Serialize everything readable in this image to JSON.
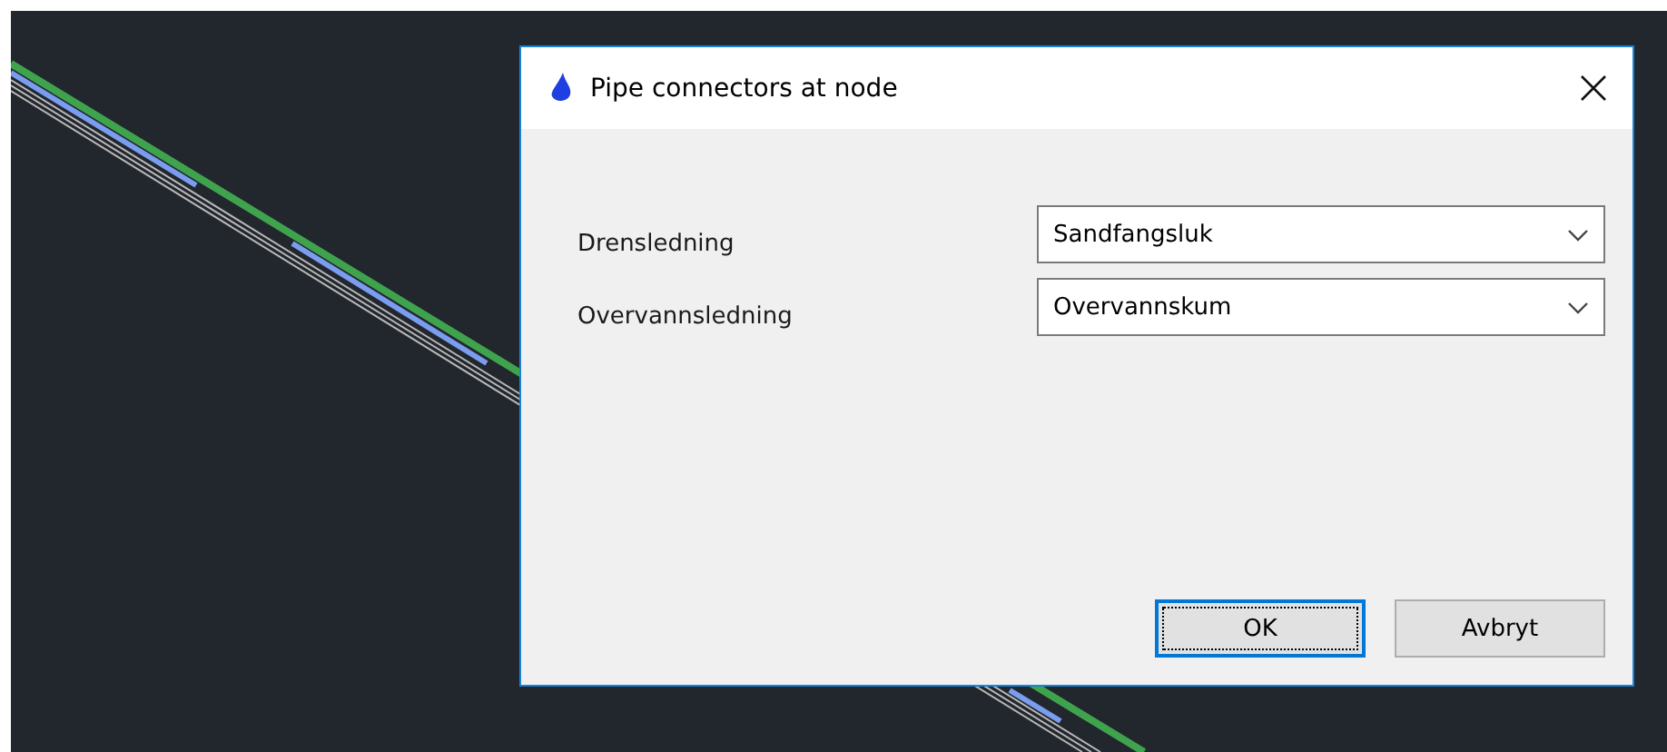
{
  "dialog": {
    "title": "Pipe connectors at node"
  },
  "fields": [
    {
      "label": "Drensledning",
      "value": "Sandfangsluk"
    },
    {
      "label": "Overvannsledning",
      "value": "Overvannskum"
    }
  ],
  "buttons": [
    {
      "label": "OK",
      "focused": true
    },
    {
      "label": "Avbryt",
      "focused": false
    }
  ]
}
